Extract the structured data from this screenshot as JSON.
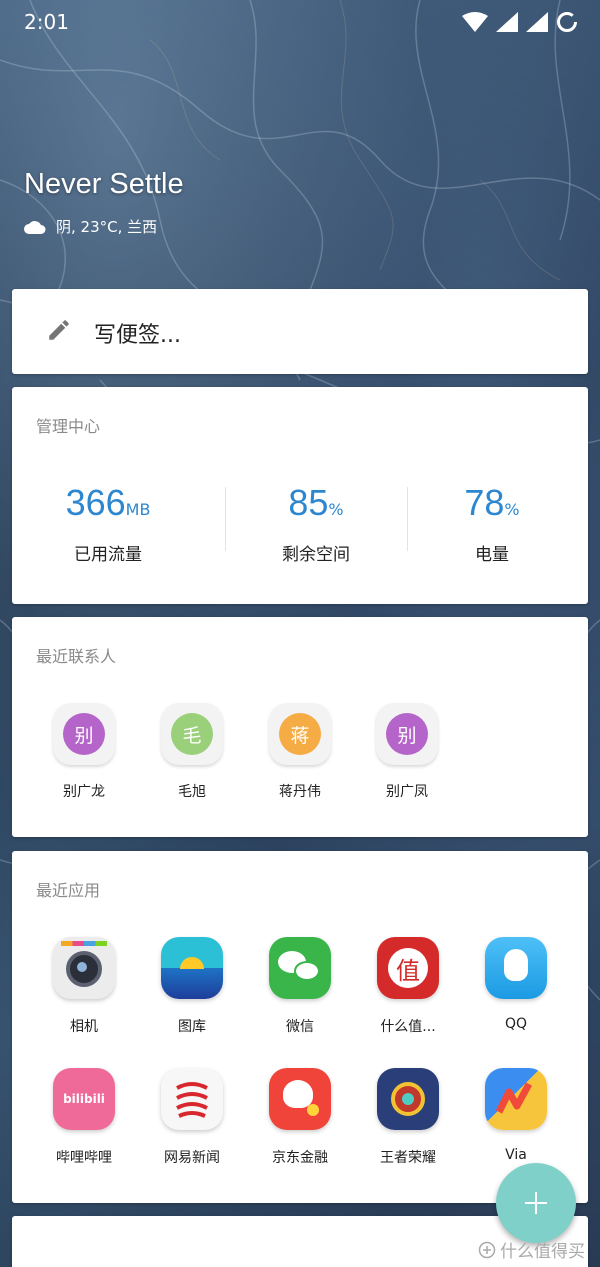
{
  "status_bar": {
    "time": "2:01"
  },
  "header": {
    "title": "Never Settle",
    "weather": "阴, 23°C, 兰西"
  },
  "note": {
    "placeholder": "写便签..."
  },
  "management": {
    "title": "管理中心",
    "stats": [
      {
        "value": "366",
        "unit": "MB",
        "label": "已用流量"
      },
      {
        "value": "85",
        "unit": "%",
        "label": "剩余空间"
      },
      {
        "value": "78",
        "unit": "%",
        "label": "电量"
      }
    ]
  },
  "contacts": {
    "title": "最近联系人",
    "items": [
      {
        "initial": "别",
        "name": "别广龙",
        "color": "#b565c9"
      },
      {
        "initial": "毛",
        "name": "毛旭",
        "color": "#9bd07a"
      },
      {
        "initial": "蒋",
        "name": "蒋丹伟",
        "color": "#f6ac45"
      },
      {
        "initial": "别",
        "name": "别广凤",
        "color": "#b565c9"
      }
    ]
  },
  "apps": {
    "title": "最近应用",
    "items": [
      {
        "name": "相机",
        "icon": "camera-icon"
      },
      {
        "name": "图库",
        "icon": "gallery-icon"
      },
      {
        "name": "微信",
        "icon": "wechat-icon"
      },
      {
        "name": "什么值...",
        "icon": "smzdm-icon",
        "badge": "值"
      },
      {
        "name": "QQ",
        "icon": "qq-icon"
      },
      {
        "name": "哔哩哔哩",
        "icon": "bilibili-icon",
        "badge": "bilibili"
      },
      {
        "name": "网易新闻",
        "icon": "netease-news-icon"
      },
      {
        "name": "京东金融",
        "icon": "jd-finance-icon"
      },
      {
        "name": "王者荣耀",
        "icon": "honor-of-kings-icon"
      },
      {
        "name": "Via",
        "icon": "via-icon"
      }
    ]
  },
  "watermark": {
    "text": "什么值得买"
  },
  "colors": {
    "accent": "#2d87d0",
    "fab": "#7fd0c8"
  }
}
